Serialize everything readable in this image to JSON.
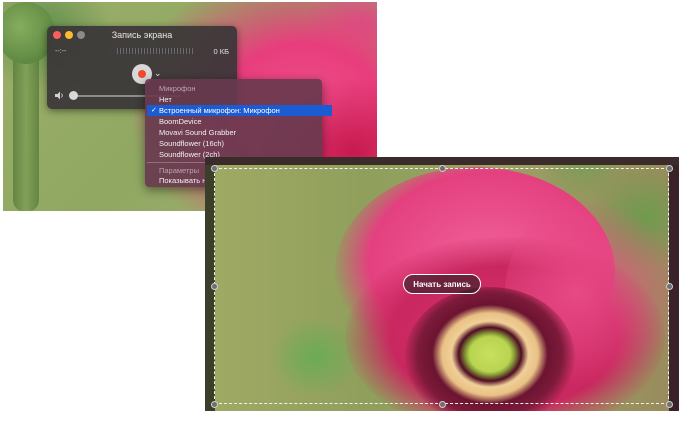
{
  "recorder": {
    "title": "Запись экрана",
    "time": "--:--",
    "file_size": "0 КБ",
    "record_button_icon": "record-icon",
    "options_icon": "chevron-down-icon",
    "volume_icon": "speaker-icon"
  },
  "options_menu": {
    "microphone_header": "Микрофон",
    "microphone_items": [
      {
        "label": "Нет",
        "selected": false
      },
      {
        "label": "Встроенный микрофон: Микрофон",
        "selected": true
      },
      {
        "label": "BoomDevice",
        "selected": false
      },
      {
        "label": "Movavi Sound Grabber",
        "selected": false
      },
      {
        "label": "Soundflower (16ch)",
        "selected": false
      },
      {
        "label": "Soundflower (2ch)",
        "selected": false
      }
    ],
    "check_mark": "✓",
    "parameters_header": "Параметры",
    "parameters_items": [
      {
        "label": "Показывать нажатия мышью в записи"
      }
    ]
  },
  "selection": {
    "start_label": "Начать запись"
  },
  "colors": {
    "menu_highlight": "#1c5cd2",
    "record_red": "#f04a2c"
  }
}
